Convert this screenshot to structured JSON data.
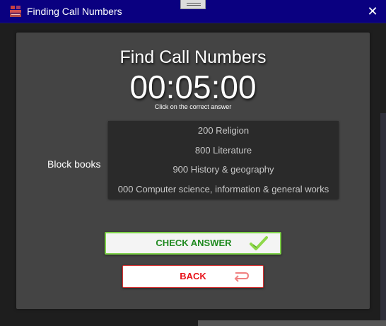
{
  "window": {
    "title": "Finding Call Numbers",
    "close_glyph": "✕"
  },
  "quiz": {
    "heading": "Find Call Numbers",
    "timer": "00:05:00",
    "instruction": "Click on the correct answer",
    "question_label": "Block books",
    "answers": [
      "200 Religion",
      "800 Literature",
      "900 History & geography",
      "000 Computer science, information & general works"
    ]
  },
  "buttons": {
    "check_label": "CHECK ANSWER",
    "back_label": "BACK"
  },
  "icons": {
    "app": "book-stack-icon",
    "check": "checkmark-icon",
    "back": "return-arrow-icon",
    "close": "close-icon"
  },
  "colors": {
    "titlebar": "#0a0080",
    "panel": "#444444",
    "answers_bg": "#2a2a2a",
    "check_text": "#1f8a1f",
    "check_border": "#7fd24a",
    "back_text": "#e8141b"
  }
}
